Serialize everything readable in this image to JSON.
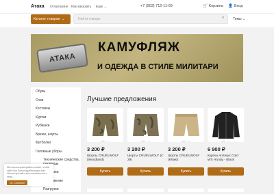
{
  "header": {
    "brand": "Атака",
    "nav": [
      "О магазине",
      "Как заказать",
      "Еще"
    ],
    "phone": "+7 (903) 712-11-69",
    "cart_label": "Корзина",
    "login_label": "Вход"
  },
  "toolbar": {
    "catalog_label": "Каталог товаров",
    "search_placeholder": "Найти товары",
    "themes_label": "Темы"
  },
  "banner": {
    "tag_text": "АТАКА",
    "title": "КАМУФЛЯЖ",
    "subtitle": "И ОДЕЖДА В СТИЛЕ МИЛИТАРИ"
  },
  "sidebar": {
    "items": [
      "Обувь",
      "Очки",
      "Костюмы",
      "Куртки",
      "Рубашки",
      "Брюки, шорты",
      "Футболки",
      "Головные уборы",
      "Технические средства, рукавицы",
      "Разгрузки",
      "Снаряжение",
      "Разгрузки"
    ]
  },
  "main": {
    "section_title": "Лучшие предложения",
    "buy_label": "Купить",
    "products": [
      {
        "price": "3 200 ₽",
        "name": "Шорты CRUELWOLF (Woodland)",
        "color": "#7a6e4c"
      },
      {
        "price": "3 200 ₽",
        "name": "Шорты CRUELWOLF (C 29)",
        "color": "#7d7256"
      },
      {
        "price": "3 200 ₽",
        "name": "Шорты CRUELWOLF (Khaki)",
        "color": "#cbb588"
      },
      {
        "price": "6 900 ₽",
        "name": "Куртка Arcteryx Cold WX Hoody - Black",
        "color": "#222222"
      }
    ]
  },
  "cookie": {
    "text": "Мы используем файлы cookie, чтобы сайт был более удобным для вас. Используя сайт, вы соглашаетесь с этим.",
    "button": "Ок, Согласен"
  },
  "colors": {
    "accent": "#b06b16"
  }
}
